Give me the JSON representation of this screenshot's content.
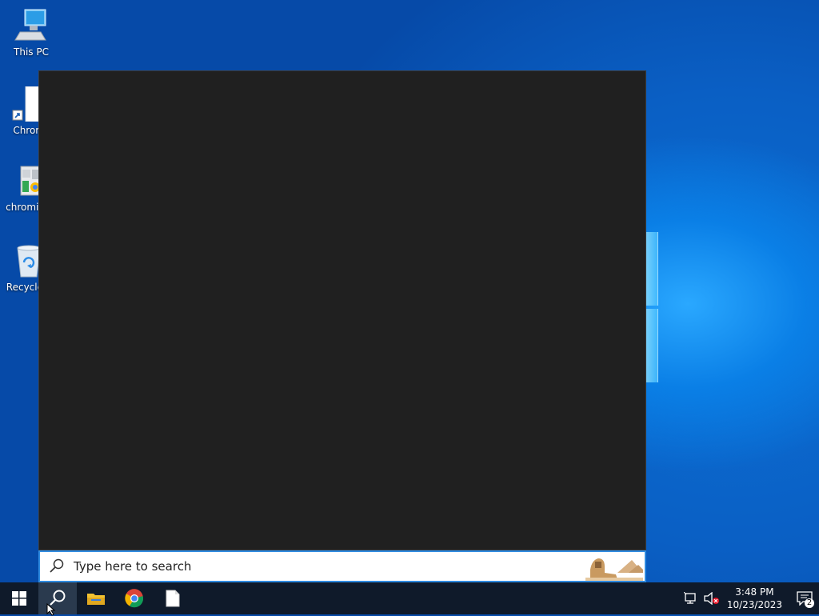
{
  "desktop": {
    "icons": [
      {
        "label": "This PC"
      },
      {
        "label": "Chrom"
      },
      {
        "label": "chromiu"
      },
      {
        "label": "Recycle"
      }
    ]
  },
  "search": {
    "placeholder": "Type here to search"
  },
  "taskbar": {
    "pinned": [
      "windows-start",
      "search",
      "file-explorer",
      "chrome",
      "file"
    ]
  },
  "tray": {
    "time": "3:48 PM",
    "date": "10/23/2023",
    "notification_count": "2"
  }
}
